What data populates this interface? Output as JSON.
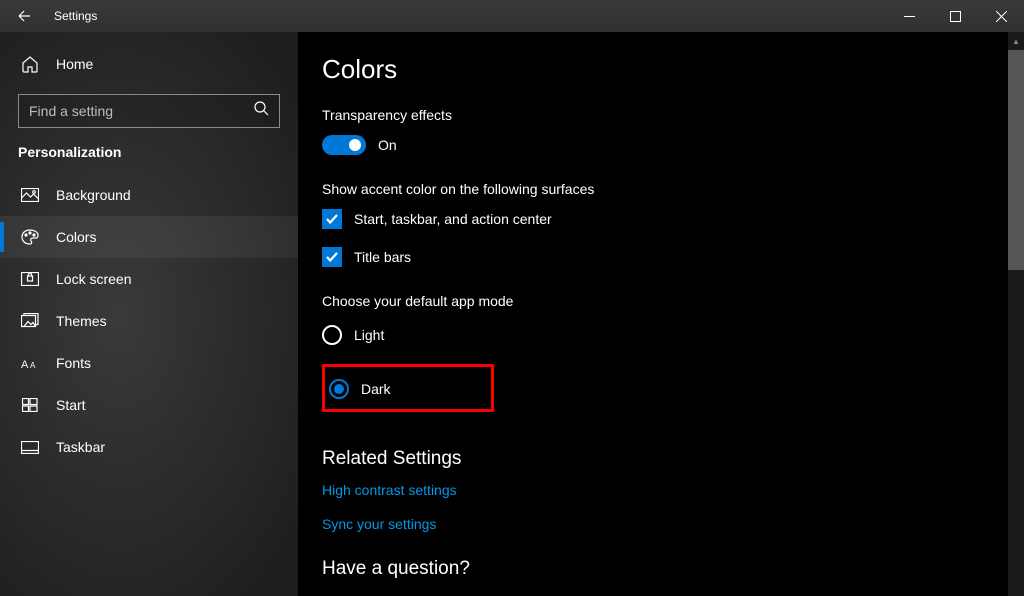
{
  "window": {
    "title": "Settings"
  },
  "sidebar": {
    "home": "Home",
    "search_placeholder": "Find a setting",
    "category": "Personalization",
    "items": [
      {
        "icon": "picture",
        "label": "Background"
      },
      {
        "icon": "palette",
        "label": "Colors"
      },
      {
        "icon": "lock",
        "label": "Lock screen"
      },
      {
        "icon": "themes",
        "label": "Themes"
      },
      {
        "icon": "fonts",
        "label": "Fonts"
      },
      {
        "icon": "start",
        "label": "Start"
      },
      {
        "icon": "taskbar",
        "label": "Taskbar"
      }
    ]
  },
  "content": {
    "title": "Colors",
    "transparency": {
      "label": "Transparency effects",
      "state": "On"
    },
    "surfaces": {
      "label": "Show accent color on the following surfaces",
      "opts": [
        "Start, taskbar, and action center",
        "Title bars"
      ]
    },
    "appmode": {
      "label": "Choose your default app mode",
      "light": "Light",
      "dark": "Dark"
    },
    "related": {
      "title": "Related Settings",
      "links": [
        "High contrast settings",
        "Sync your settings"
      ]
    },
    "question": "Have a question?"
  },
  "colors": {
    "accent": "#0078d7",
    "link": "#0597e4"
  }
}
